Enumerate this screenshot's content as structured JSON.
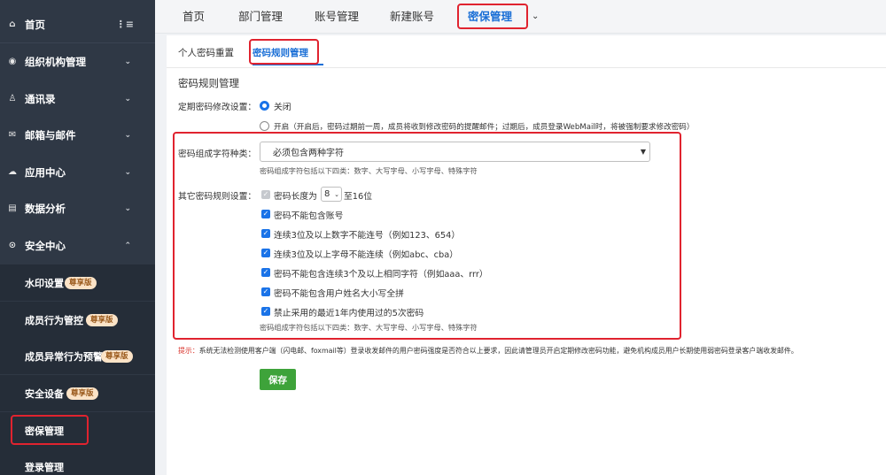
{
  "sidebar": {
    "items": [
      {
        "label": "首页",
        "icon": "home-icon"
      },
      {
        "label": "组织机构管理",
        "icon": "database-icon"
      },
      {
        "label": "通讯录",
        "icon": "user-icon"
      },
      {
        "label": "邮箱与邮件",
        "icon": "mail-icon"
      },
      {
        "label": "应用中心",
        "icon": "cloud-icon"
      },
      {
        "label": "数据分析",
        "icon": "chart-icon"
      },
      {
        "label": "安全中心",
        "icon": "shield-icon"
      }
    ],
    "sub_items": [
      {
        "label": "水印设置",
        "badge": "尊享版"
      },
      {
        "label": "成员行为管控",
        "badge": "尊享版"
      },
      {
        "label": "成员异常行为预警",
        "badge": "尊享版"
      },
      {
        "label": "安全设备",
        "badge": "尊享版"
      },
      {
        "label": "密保管理"
      },
      {
        "label": "登录管理"
      }
    ]
  },
  "topnav": {
    "tabs": [
      "首页",
      "部门管理",
      "账号管理",
      "新建账号",
      "密保管理"
    ],
    "more_icon": "chevron-down-icon"
  },
  "subtabs": [
    "个人密码重置",
    "密码规则管理"
  ],
  "section_title": "密码规则管理",
  "periodic": {
    "label": "定期密码修改设置：",
    "off_label": "关闭",
    "on_label": "开启（开启后，密码过期前一周，成员将收到修改密码的提醒邮件；过期后，成员登录WebMail时，将被强制要求修改密码）"
  },
  "composition": {
    "label": "密码组成字符种类：",
    "selected": "必须包含两种字符",
    "hint": "密码组成字符包括以下四类：数字、大写字母、小写字母、特殊字符"
  },
  "other_rules": {
    "label": "其它密码规则设置：",
    "length_prefix": "密码长度为",
    "length_value": "8",
    "length_suffix": "至16位",
    "rules": [
      "密码不能包含账号",
      "连续3位及以上数字不能连号（例如123、654）",
      "连续3位及以上字母不能连续（例如abc、cba）",
      "密码不能包含连续3个及以上相同字符（例如aaa、rrr）",
      "密码不能包含用户姓名大小写全拼",
      "禁止采用的最近1年内使用过的5次密码"
    ],
    "hint": "密码组成字符包括以下四类：数字、大写字母、小写字母、特殊字符"
  },
  "tip": {
    "prefix": "提示：",
    "text": "系统无法检测使用客户端（闪电邮、foxmail等）登录收发邮件的用户密码强度是否符合以上要求，因此请管理员开启定期修改密码功能，避免机构成员用户长期使用弱密码登录客户端收发邮件。"
  },
  "save_label": "保存",
  "colors": {
    "accent": "#1a6fd6",
    "highlight": "#e0232f",
    "save": "#3ea33a",
    "badge_bg": "#fbe3c7"
  }
}
